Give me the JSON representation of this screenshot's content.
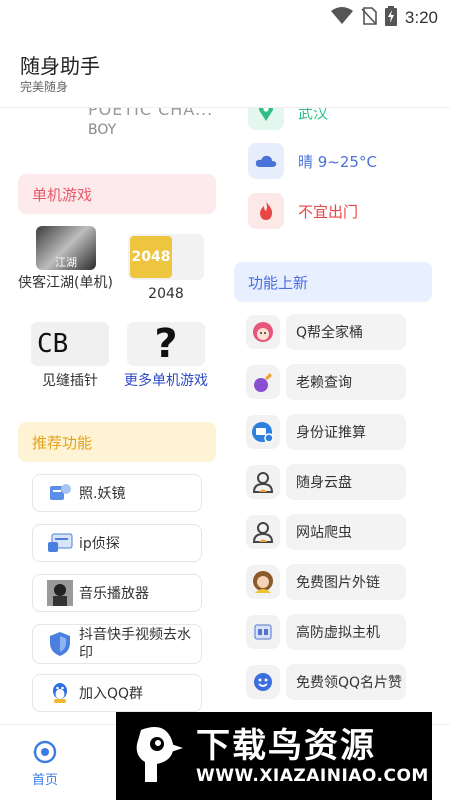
{
  "status": {
    "time": "3:20"
  },
  "header": {
    "title": "随身助手",
    "subtitle": "完美随身"
  },
  "music": {
    "title": "POETIC CHA...",
    "artist": "BOY"
  },
  "games": {
    "heading": "单机游戏",
    "items": [
      {
        "name": "侠客江湖(单机)",
        "thumb_text": "江湖"
      },
      {
        "name": "2048",
        "thumb_text": "2048"
      },
      {
        "name": "见缝插针",
        "thumb_text": "CB"
      },
      {
        "name": "更多单机游戏",
        "thumb_text": "?"
      }
    ]
  },
  "recommended": {
    "heading": "推荐功能",
    "items": [
      {
        "label": "照.妖镜",
        "icon": "mirror-icon"
      },
      {
        "label": "ip侦探",
        "icon": "ip-detective-icon"
      },
      {
        "label": "音乐播放器",
        "icon": "music-player-icon"
      },
      {
        "label": "抖音快手视频去水印",
        "icon": "shield-icon"
      },
      {
        "label": "加入QQ群",
        "icon": "qq-penguin-icon"
      }
    ]
  },
  "info": {
    "city": "武汉",
    "weather": "晴 9~25°C",
    "advice": "不宜出门",
    "colors": {
      "city": "#2fbf86",
      "weather": "#4a72d8",
      "advice": "#e84545"
    }
  },
  "new_features": {
    "heading": "功能上新",
    "items": [
      {
        "label": "Q帮全家桶",
        "icon": "character-icon"
      },
      {
        "label": "老赖查询",
        "icon": "eggplant-icon"
      },
      {
        "label": "身份证推算",
        "icon": "id-card-icon"
      },
      {
        "label": "随身云盘",
        "icon": "user-icon"
      },
      {
        "label": "网站爬虫",
        "icon": "user-icon"
      },
      {
        "label": "免费图片外链",
        "icon": "girl-avatar-icon"
      },
      {
        "label": "高防虚拟主机",
        "icon": "server-icon"
      },
      {
        "label": "免费领QQ名片赞",
        "icon": "qq-face-icon"
      }
    ]
  },
  "nav": {
    "home_label": "首页"
  },
  "watermark": {
    "name": "下载鸟资源",
    "url": "WWW.XIAZAINIAO.COM"
  }
}
